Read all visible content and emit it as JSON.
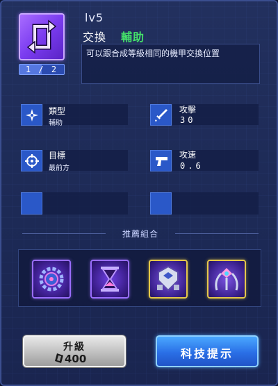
{
  "header": {
    "level": "lv5",
    "name": "交換",
    "type_tag": "輔助",
    "description": "可以跟合成等級相同的機甲交換位置",
    "level_progress": {
      "current": "1",
      "separator": "/",
      "max": "2",
      "fraction": 0.5
    }
  },
  "stats": {
    "type": {
      "label": "類型",
      "value": "輔助",
      "icon": "shuriken-icon"
    },
    "attack": {
      "label": "攻擊",
      "value": "30",
      "icon": "sword-icon"
    },
    "target": {
      "label": "目標",
      "value": "最前方",
      "icon": "crosshair-icon"
    },
    "attack_speed": {
      "label": "攻速",
      "value": "0.6",
      "icon": "pistol-icon"
    }
  },
  "recommended": {
    "title": "推薦組合",
    "cards": [
      {
        "icon": "gear-mech-icon",
        "frame": "purple"
      },
      {
        "icon": "hourglass-icon",
        "frame": "purple"
      },
      {
        "icon": "shield-mech-icon",
        "frame": "gold"
      },
      {
        "icon": "claw-mech-icon",
        "frame": "gold"
      }
    ]
  },
  "buttons": {
    "upgrade_label": "升級",
    "upgrade_cost": "400",
    "tech_hint_label": "科技提示"
  },
  "colors": {
    "type_tag": "#44e06a",
    "panel_bg": "#1d2a56",
    "accent_blue": "#2a58c8",
    "skill_purple": "#7b3cf0"
  }
}
